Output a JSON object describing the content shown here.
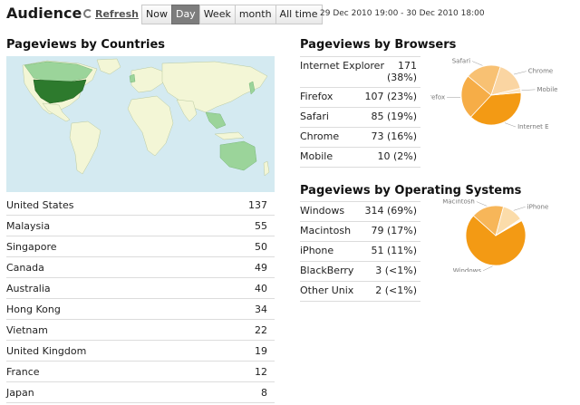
{
  "header": {
    "title": "Audience",
    "refresh_label": "Refresh",
    "range_buttons": [
      "Now",
      "Day",
      "Week",
      "month",
      "All time"
    ],
    "active_range": "Day",
    "date_range": "29 Dec 2010 19:00 - 30 Dec 2010 18:00"
  },
  "countries": {
    "title": "Pageviews by Countries",
    "rows": [
      {
        "name": "United States",
        "value": "137"
      },
      {
        "name": "Malaysia",
        "value": "55"
      },
      {
        "name": "Singapore",
        "value": "50"
      },
      {
        "name": "Canada",
        "value": "49"
      },
      {
        "name": "Australia",
        "value": "40"
      },
      {
        "name": "Hong Kong",
        "value": "34"
      },
      {
        "name": "Vietnam",
        "value": "22"
      },
      {
        "name": "United Kingdom",
        "value": "19"
      },
      {
        "name": "France",
        "value": "12"
      },
      {
        "name": "Japan",
        "value": "8"
      }
    ]
  },
  "browsers": {
    "title": "Pageviews by Browsers",
    "rows": [
      {
        "name": "Internet Explorer",
        "value": "171\n(38%)"
      },
      {
        "name": "Firefox",
        "value": "107 (23%)"
      },
      {
        "name": "Safari",
        "value": "85 (19%)"
      },
      {
        "name": "Chrome",
        "value": "73 (16%)"
      },
      {
        "name": "Mobile",
        "value": "10 (2%)"
      }
    ],
    "pie_labels": [
      "Internet E",
      "Firefox",
      "Safari",
      "Chrome",
      "Mobile"
    ]
  },
  "os": {
    "title": "Pageviews by Operating Systems",
    "rows": [
      {
        "name": "Windows",
        "value": "314 (69%)"
      },
      {
        "name": "Macintosh",
        "value": "79 (17%)"
      },
      {
        "name": "iPhone",
        "value": "51 (11%)"
      },
      {
        "name": "BlackBerry",
        "value": "3 (<1%)"
      },
      {
        "name": "Other Unix",
        "value": "2 (<1%)"
      }
    ],
    "pie_labels": [
      "Windows",
      "Macintosh",
      "iPhone"
    ]
  },
  "chart_data": [
    {
      "type": "pie",
      "title": "Pageviews by Browsers",
      "categories": [
        "Internet Explorer",
        "Firefox",
        "Safari",
        "Chrome",
        "Mobile"
      ],
      "values": [
        171,
        107,
        85,
        73,
        10
      ],
      "colors": [
        "#f39a14",
        "#f6ad47",
        "#f8c173",
        "#fad5a2",
        "#fce6c6"
      ]
    },
    {
      "type": "pie",
      "title": "Pageviews by Operating Systems",
      "categories": [
        "Windows",
        "Macintosh",
        "iPhone",
        "BlackBerry",
        "Other Unix"
      ],
      "values": [
        314,
        79,
        51,
        3,
        2
      ],
      "colors": [
        "#f39a14",
        "#f7b659",
        "#fbdcaa",
        "#fde8c8",
        "#fef0da"
      ]
    }
  ],
  "colors": {
    "accent": "#f39a14",
    "map_water": "#d4eaf1",
    "map_land": "#f3f6d6",
    "map_highlight_dark": "#2d7a2d",
    "map_highlight_light": "#9bd49a"
  }
}
